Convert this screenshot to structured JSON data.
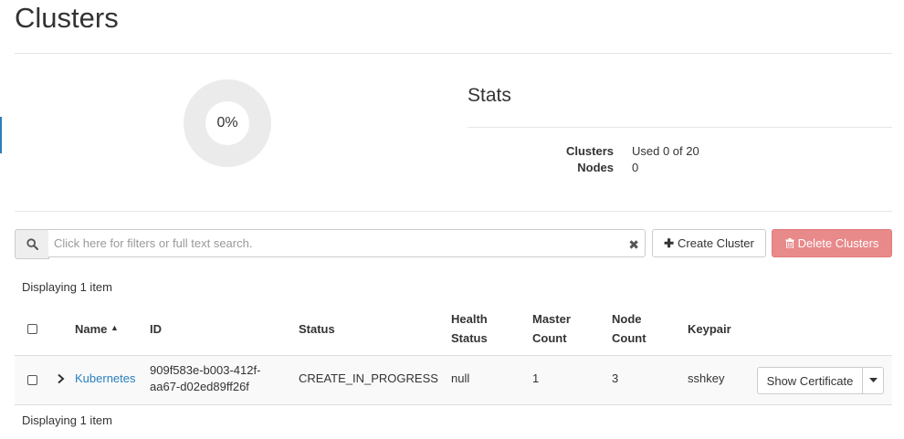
{
  "page": {
    "title": "Clusters"
  },
  "quota": {
    "percent_label": "0%",
    "percent_used": 0
  },
  "stats": {
    "title": "Stats",
    "rows": [
      {
        "label": "Clusters",
        "value": "Used 0 of 20"
      },
      {
        "label": "Nodes",
        "value": "0"
      }
    ]
  },
  "toolbar": {
    "search_placeholder": "Click here for filters or full text search.",
    "search_value": "",
    "create_label": "Create Cluster",
    "delete_label": "Delete Clusters"
  },
  "table": {
    "displaying_top": "Displaying 1 item",
    "displaying_bottom": "Displaying 1 item",
    "headers": {
      "name": "Name",
      "id": "ID",
      "status": "Status",
      "health_line1": "Health",
      "health_line2": "Status",
      "master_line1": "Master",
      "master_line2": "Count",
      "node_line1": "Node",
      "node_line2": "Count",
      "keypair": "Keypair"
    },
    "rows": [
      {
        "name": "Kubernetes",
        "id_line1": "909f583e-b003-412f-",
        "id_line2": "aa67-d02ed89ff26f",
        "status": "CREATE_IN_PROGRESS",
        "health_status": "null",
        "master_count": "1",
        "node_count": "3",
        "keypair": "sshkey",
        "action_label": "Show Certificate"
      }
    ]
  },
  "icons": {
    "search": "search-icon",
    "clear": "clear-icon",
    "plus": "plus-icon",
    "trash": "trash-icon",
    "sort": "sort-asc-icon",
    "expand": "chevron-right-icon",
    "caret": "caret-down-icon"
  },
  "colors": {
    "link": "#2a7fbf",
    "danger": "#e8898a",
    "donut": "#ebebeb"
  }
}
